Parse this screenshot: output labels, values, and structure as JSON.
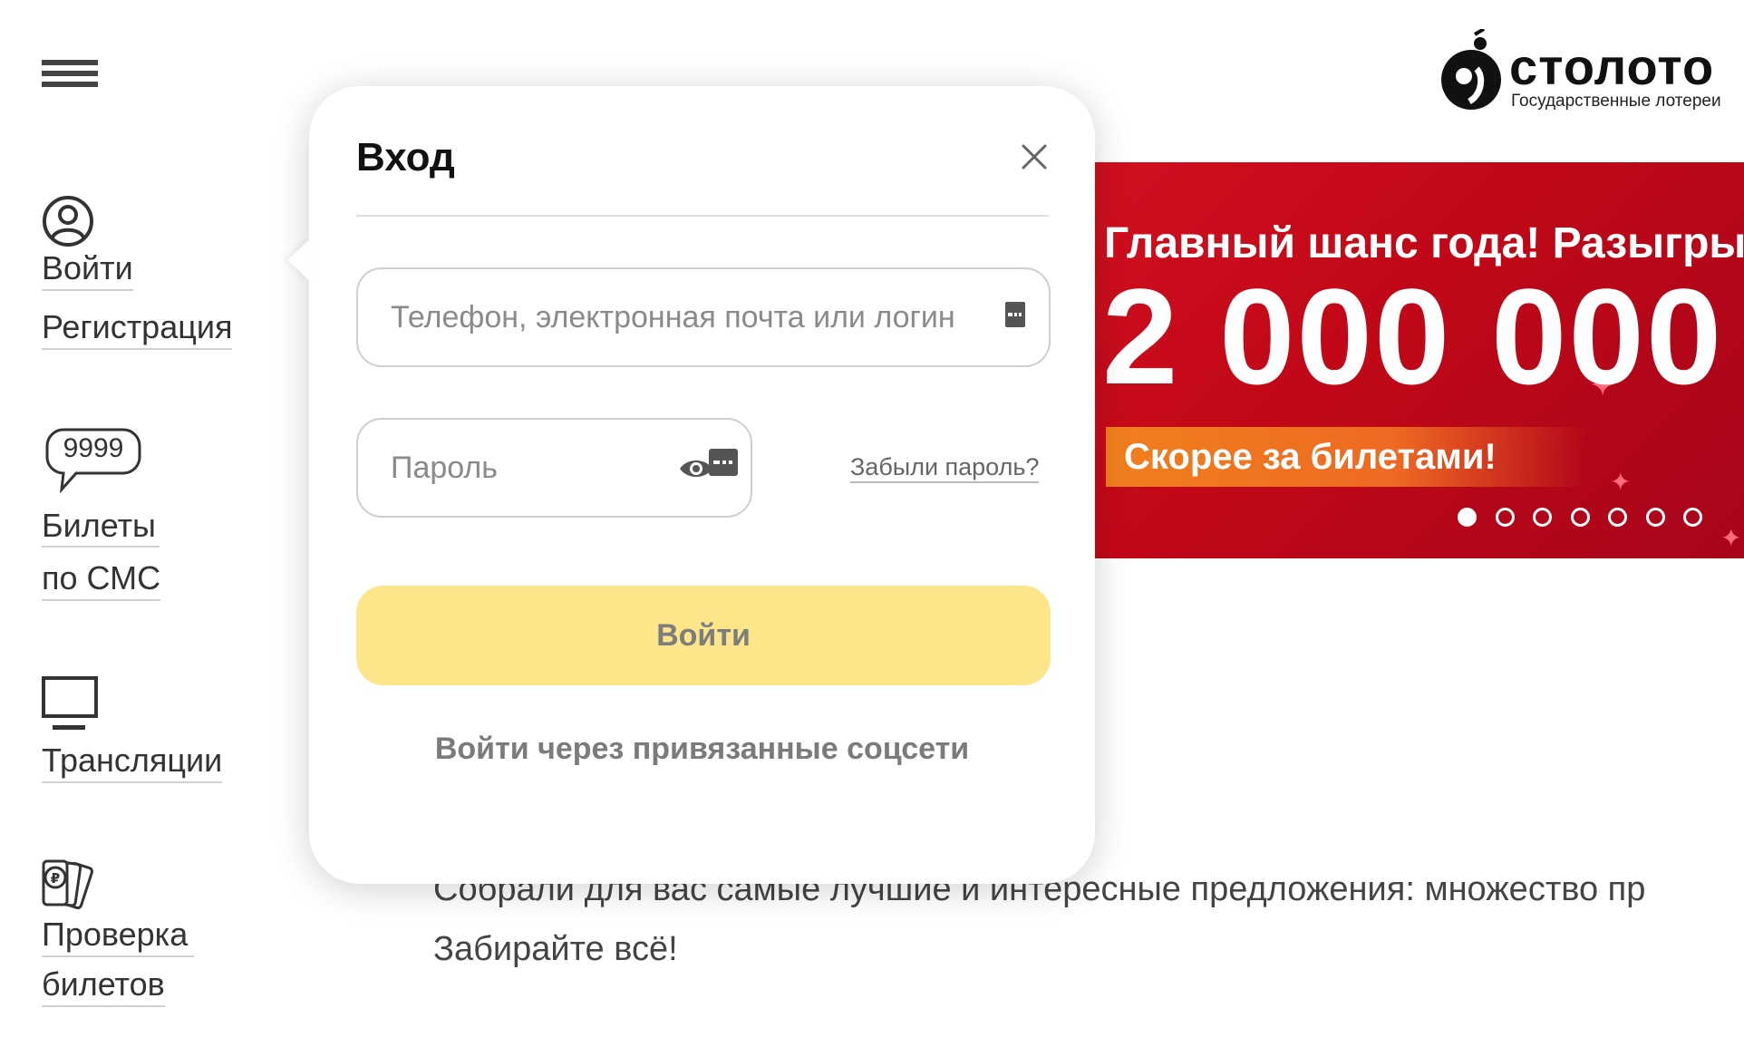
{
  "header": {
    "logo_name": "столото",
    "logo_tagline": "Государственные лотереи"
  },
  "sidebar": {
    "items": [
      {
        "icon": "user-circle-icon",
        "label": "Войти"
      },
      {
        "icon": "",
        "label": "Регистрация"
      },
      {
        "icon": "sms-bubble-icon",
        "icon_text": "9999",
        "label_line1": "Билеты",
        "label_line2": "по СМС"
      },
      {
        "icon": "tv-icon",
        "label": "Трансляции"
      },
      {
        "icon": "ticket-check-icon",
        "label_line1": "Проверка",
        "label_line2": "билетов"
      }
    ]
  },
  "login_popup": {
    "title": "Вход",
    "close_icon": "close-icon",
    "login_placeholder": "Телефон, электронная почта или логин",
    "password_placeholder": "Пароль",
    "forgot_password": "Забыли пароль?",
    "submit_label": "Войти",
    "social_login": "Войти через привязанные соцсети",
    "colors": {
      "submit_bg": "#fde68a"
    }
  },
  "banner": {
    "headline": "Главный шанс года! Разыгрыв",
    "amount": "2 000 000",
    "cta": "Скорее за билетами!",
    "slides_total": 7,
    "active_slide": 1,
    "colors": {
      "background": "#c70a1b",
      "cta": "#f07f1d"
    }
  },
  "promo": {
    "line1": "Собрали для вас самые лучшие и интересные предложения: множество пр",
    "line2": "Забирайте всё!"
  }
}
